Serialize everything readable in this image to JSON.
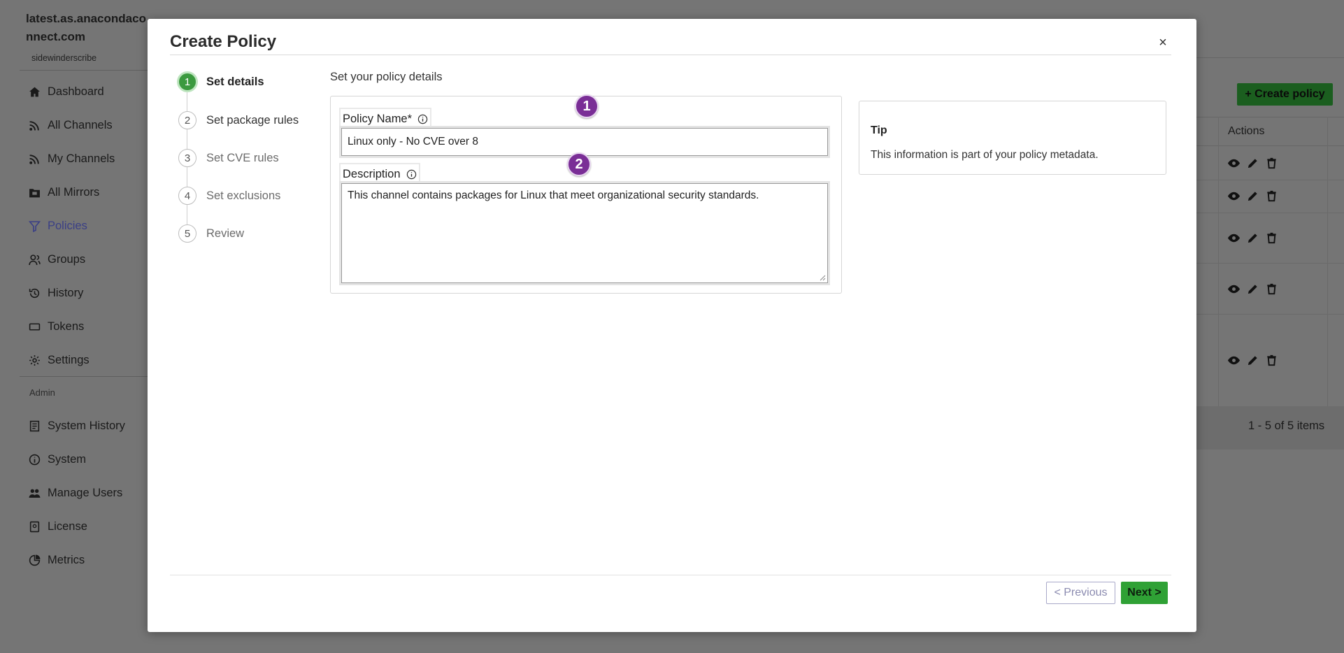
{
  "app": {
    "host": "latest.as.anacondaconnect.com",
    "org": "sidewinderscribe",
    "nav": [
      {
        "label": "Dashboard",
        "icon": "home-icon"
      },
      {
        "label": "All Channels",
        "icon": "channels-icon"
      },
      {
        "label": "My Channels",
        "icon": "channels-icon"
      },
      {
        "label": "All Mirrors",
        "icon": "mirror-icon"
      },
      {
        "label": "Policies",
        "icon": "filter-icon",
        "active": true
      },
      {
        "label": "Groups",
        "icon": "groups-icon"
      },
      {
        "label": "History",
        "icon": "history-icon"
      },
      {
        "label": "Tokens",
        "icon": "token-icon"
      },
      {
        "label": "Settings",
        "icon": "gear-icon"
      }
    ],
    "admin_label": "Admin",
    "admin_nav": [
      {
        "label": "System History",
        "icon": "document-icon"
      },
      {
        "label": "System",
        "icon": "info-icon"
      },
      {
        "label": "Manage Users",
        "icon": "users-icon"
      },
      {
        "label": "License",
        "icon": "license-icon"
      },
      {
        "label": "Metrics",
        "icon": "metrics-icon"
      }
    ],
    "create_policy_label": "+ Create policy",
    "actions_header": "Actions",
    "pager_text": "1 - 5 of 5 items"
  },
  "modal": {
    "title": "Create Policy",
    "close_label": "×",
    "steps": [
      {
        "num": "1",
        "label": "Set details",
        "state": "active"
      },
      {
        "num": "2",
        "label": "Set package rules",
        "state": "normal"
      },
      {
        "num": "3",
        "label": "Set CVE rules",
        "state": "muted"
      },
      {
        "num": "4",
        "label": "Set exclusions",
        "state": "muted"
      },
      {
        "num": "5",
        "label": "Review",
        "state": "muted"
      }
    ],
    "section_heading": "Set your policy details",
    "policy_name_label": "Policy Name*",
    "policy_name_value": "Linux only - No CVE over 8",
    "description_label": "Description",
    "description_value": "This channel contains packages for Linux that meet organizational security standards.",
    "badges": [
      "1",
      "2"
    ],
    "tip_title": "Tip",
    "tip_text": "This information is part of your policy metadata.",
    "prev_label": "< Previous",
    "next_label": "Next >"
  },
  "colors": {
    "accent_green": "#2fa135",
    "badge_purple": "#7a2e96",
    "active_nav": "#3a3f86"
  }
}
